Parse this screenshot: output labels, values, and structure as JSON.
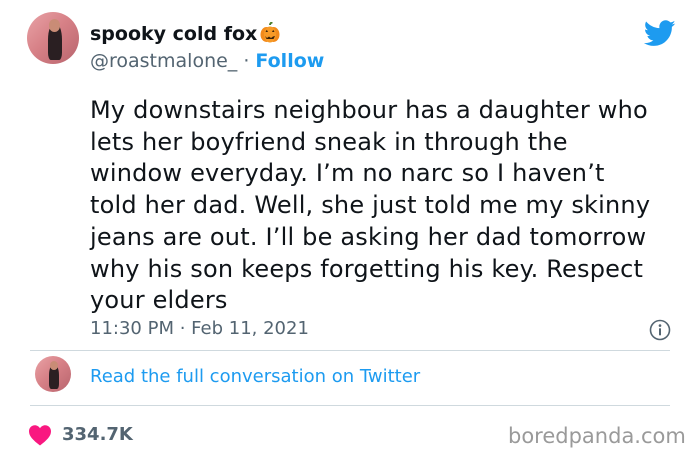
{
  "author": {
    "name": "spooky cold fox",
    "handle": "@roastmalone_",
    "separator": " · ",
    "follow_label": "Follow",
    "name_icon": "pumpkin-icon"
  },
  "tweet": {
    "lines": [
      "My downstairs neighbour has a daughter who",
      "lets her boyfriend sneak in through the",
      "window everyday. I’m no narc so I haven’t",
      "told her dad. Well, she just told me my skinny",
      "jeans are out. I’ll be asking her dad tomorrow",
      "why his son keeps forgetting his key. Respect",
      "your elders"
    ],
    "timestamp": "11:30 PM · Feb 11, 2021"
  },
  "conversation_link": "Read the full conversation on Twitter",
  "likes": {
    "count": "334.7K",
    "icon": "heart-icon"
  },
  "watermark": "boredpanda.com",
  "colors": {
    "accent": "#1d9bf0",
    "text": "#0f1419",
    "muted": "#536471",
    "like": "#f91880",
    "divider": "#cfd9de"
  }
}
